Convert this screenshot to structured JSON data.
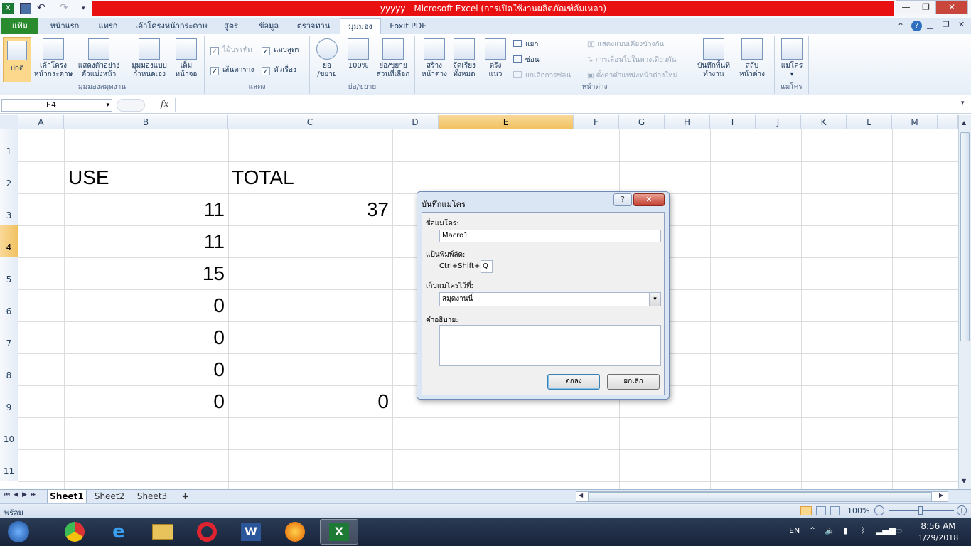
{
  "window": {
    "title": "yyyyy - Microsoft Excel (การเปิดใช้งานผลิตภัณฑ์ล้มเหลว)",
    "title_bg": "#e81010"
  },
  "tabs": [
    {
      "label": "แฟ้ม"
    },
    {
      "label": "หน้าแรก"
    },
    {
      "label": "แทรก"
    },
    {
      "label": "เค้าโครงหน้ากระดาษ"
    },
    {
      "label": "สูตร"
    },
    {
      "label": "ข้อมูล"
    },
    {
      "label": "ตรวจทาน"
    },
    {
      "label": "มุมมอง"
    },
    {
      "label": "Foxit PDF"
    }
  ],
  "ribbon": {
    "workbook_views": {
      "label": "มุมมองสมุดงาน",
      "normal": "ปกติ",
      "page_layout_1": "เค้าโครง",
      "page_layout_2": "หน้ากระดาษ",
      "page_break_1": "แสดงตัวอย่าง",
      "page_break_2": "ตัวแบ่งหน้า",
      "custom_1": "มุมมองแบบ",
      "custom_2": "กำหนดเอง",
      "full_1": "เต็ม",
      "full_2": "หน้าจอ"
    },
    "show": {
      "label": "แสดง",
      "ruler": "ไม้บรรทัด",
      "formula_bar": "แถบสูตร",
      "gridlines": "เส้นตาราง",
      "headings": "หัวเรื่อง"
    },
    "zoom": {
      "label": "ย่อ/ขยาย",
      "zoom_1": "ย่อ",
      "zoom_2": "/ขยาย",
      "hundred": "100%",
      "selection_1": "ย่อ/ขยาย",
      "selection_2": "ส่วนที่เลือก"
    },
    "window": {
      "label": "หน้าต่าง",
      "new_1": "สร้าง",
      "new_2": "หน้าต่าง",
      "arrange_1": "จัดเรียง",
      "arrange_2": "ทั้งหมด",
      "freeze_1": "ตรึง",
      "freeze_2": "แนว",
      "split": "แยก",
      "hide": "ซ่อน",
      "unhide": "ยกเลิกการซ่อน",
      "side_by_side": "แสดงแบบเคียงข้างกัน",
      "sync_scroll": "การเลื่อนไปในทางเดียวกัน",
      "reset_pos": "ตั้งค่าตำแหน่งหน้าต่างใหม่",
      "save_ws_1": "บันทึกพื้นที่",
      "save_ws_2": "ทำงาน",
      "switch_1": "สลับ",
      "switch_2": "หน้าต่าง"
    },
    "macros": {
      "label": "แมโคร",
      "btn": "แมโคร"
    }
  },
  "formula_bar": {
    "name_box": "E4",
    "fx": "fx"
  },
  "columns": [
    "A",
    "B",
    "C",
    "D",
    "E",
    "F",
    "G",
    "H",
    "I",
    "J",
    "K",
    "L",
    "M"
  ],
  "rows": [
    "1",
    "2",
    "3",
    "4",
    "5",
    "6",
    "7",
    "8",
    "9",
    "10",
    "11"
  ],
  "cells": {
    "B2": "USE",
    "C2": "TOTAL",
    "B3": "11",
    "C3": "37",
    "B4": "11",
    "B5": "15",
    "B6": "0",
    "B7": "0",
    "B8": "0",
    "B9": "0",
    "C9": "0"
  },
  "dialog": {
    "title": "บันทึกแมโคร",
    "help": "?",
    "close": "✕",
    "name_label": "ชื่อแมโคร:",
    "name_value": "Macro1",
    "shortcut_label": "แป้นพิมพ์ลัด:",
    "shortcut_prefix": "Ctrl+Shift+",
    "shortcut_value": "Q",
    "store_label": "เก็บแมโครไว้ที่:",
    "store_value": "สมุดงานนี้",
    "desc_label": "คำอธิบาย:",
    "desc_value": "",
    "ok": "ตกลง",
    "cancel": "ยกเลิก"
  },
  "sheets": [
    "Sheet1",
    "Sheet2",
    "Sheet3"
  ],
  "status": {
    "ready": "พร้อม",
    "zoom": "100%"
  },
  "taskbar": {
    "lang": "EN",
    "time": "8:56 AM",
    "date": "1/29/2018"
  },
  "colors": {
    "file_tab": "#2a8a2e",
    "selection": "#f1c15f",
    "ribbon_bg": "#e6eef8"
  }
}
